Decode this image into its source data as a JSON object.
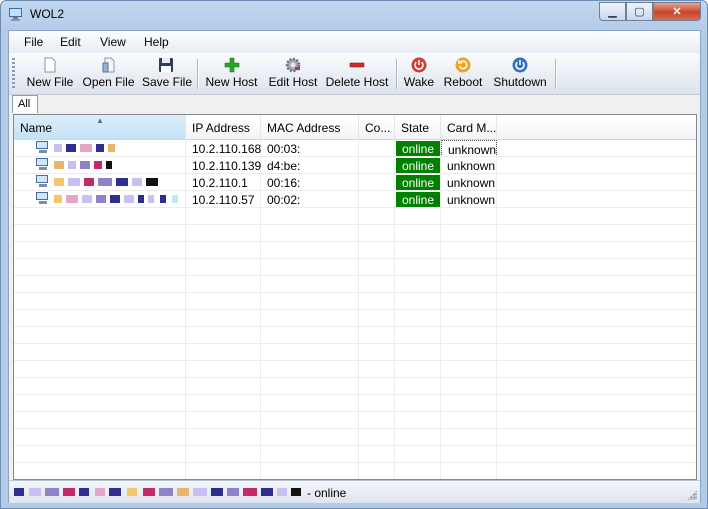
{
  "window": {
    "title": "WOL2"
  },
  "menu": [
    "File",
    "Edit",
    "View",
    "Help"
  ],
  "toolbar": {
    "new_file": "New File",
    "open_file": "Open File",
    "save_file": "Save File",
    "new_host": "New Host",
    "edit_host": "Edit Host",
    "delete_host": "Delete Host",
    "wake": "Wake",
    "reboot": "Reboot",
    "shutdown": "Shutdown"
  },
  "icons": {
    "app": "computer-icon",
    "new_file": "blank-page-icon",
    "open_file": "open-document-icon",
    "save_file": "floppy-disk-icon",
    "new_host": "green-plus-icon",
    "edit_host": "gear-icon",
    "delete_host": "red-minus-icon",
    "wake": "red-power-icon",
    "reboot": "orange-refresh-icon",
    "shutdown": "blue-power-icon"
  },
  "tabs": [
    "All"
  ],
  "table": {
    "columns": [
      "Name",
      "IP Address",
      "MAC Address",
      "Co...",
      "State",
      "Card M..."
    ],
    "rows": [
      {
        "ip": "10.2.110.168",
        "mac": "00:03:",
        "state": "online",
        "card": "unknown"
      },
      {
        "ip": "10.2.110.139",
        "mac": "d4:be:",
        "state": "online",
        "card": "unknown"
      },
      {
        "ip": "10.2.110.1",
        "mac": "00:16:",
        "state": "online",
        "card": "unknown"
      },
      {
        "ip": "10.2.110.57",
        "mac": "00:02:",
        "state": "online",
        "card": "unknown"
      }
    ]
  },
  "status": {
    "text": "- online"
  },
  "colors": {
    "online_bg": "#008000",
    "selection_header": "#c5e1f5"
  }
}
